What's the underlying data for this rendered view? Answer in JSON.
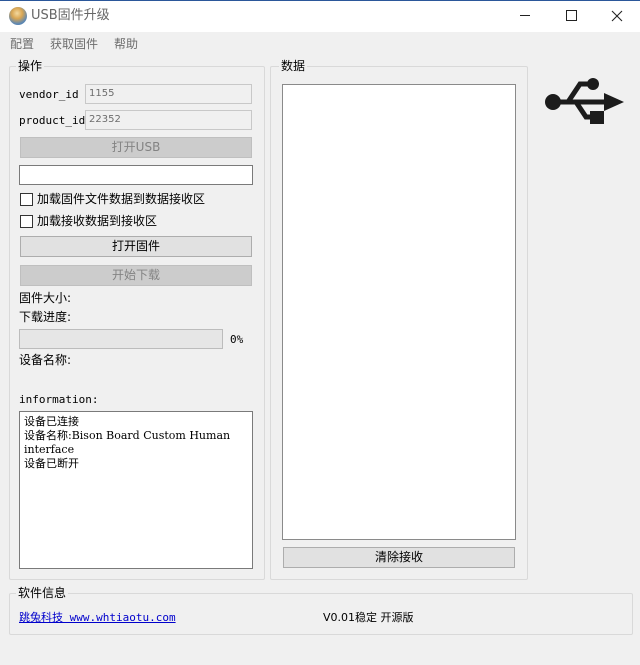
{
  "window": {
    "title": "USB固件升级",
    "icon": "app-globe-icon",
    "controls": [
      "minimize-icon",
      "maximize-icon",
      "close-icon"
    ]
  },
  "menu": {
    "items": [
      "配置",
      "获取固件",
      "帮助"
    ]
  },
  "operation": {
    "title": "操作",
    "vendor_label": "vendor_id",
    "vendor_value": "1155",
    "product_label": "product_id",
    "product_value": "22352",
    "open_usb": "打开USB",
    "path_value": "",
    "check_load_firmware": "加载固件文件数据到数据接收区",
    "check_load_received": "加载接收数据到接收区",
    "open_firmware": "打开固件",
    "start_download": "开始下载",
    "firmware_size_label": "固件大小:",
    "download_progress_label": "下载进度:",
    "progress_percent": "0%",
    "progress_value": 0,
    "device_name_label": "设备名称:",
    "information_label": "information:",
    "information_text": "设备已连接\n设备名称:Bison Board Custom Human interface\n设备已断开"
  },
  "data_panel": {
    "title": "数据",
    "clear_button": "清除接收"
  },
  "usb_icon": "usb-icon",
  "software_info": {
    "title": "软件信息",
    "link_text": "跳兔科技 www.whtiaotu.com",
    "version": "V0.01稳定 开源版"
  }
}
